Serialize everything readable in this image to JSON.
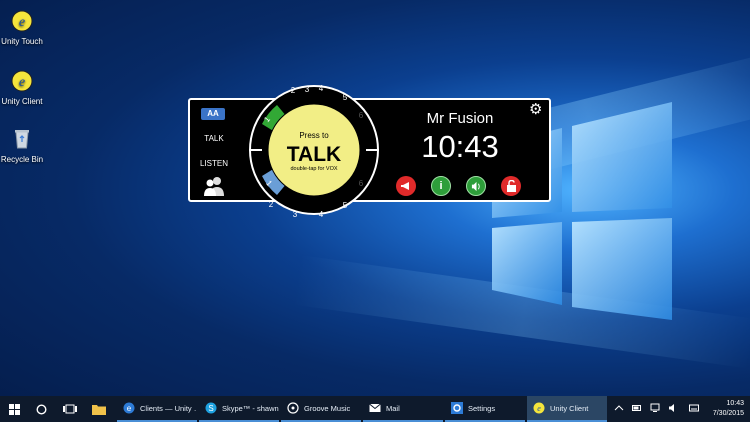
{
  "desktop": {
    "icons": [
      {
        "label": "Unity Touch",
        "icon": "unity-touch-icon"
      },
      {
        "label": "Unity Client",
        "icon": "unity-client-icon"
      },
      {
        "label": "Recycle Bin",
        "icon": "recycle-bin-icon"
      }
    ]
  },
  "widget": {
    "left": {
      "font_size_label": "AA",
      "talk_label": "TALK",
      "listen_label": "LISTEN",
      "users_icon": "users-icon"
    },
    "dial": {
      "press_to": "Press to",
      "talk": "TALK",
      "vox_hint": "double-tap for VOX",
      "top_channels": [
        "1",
        "2",
        "3",
        "4",
        "5",
        "6"
      ],
      "bottom_channels": [
        "1",
        "2",
        "3",
        "4",
        "5",
        "6"
      ]
    },
    "right": {
      "user_name": "Mr Fusion",
      "time": "10:43",
      "actions": [
        {
          "icon": "megaphone-icon",
          "color": "#e02a2a"
        },
        {
          "icon": "info-icon",
          "color": "#2e9e3a"
        },
        {
          "icon": "volume-icon",
          "color": "#2e9e3a"
        },
        {
          "icon": "unlock-icon",
          "color": "#e02a2a"
        }
      ],
      "settings_icon": "gear-icon"
    }
  },
  "taskbar": {
    "items": [
      {
        "label": "Clients — Unity …",
        "icon": "edge-icon"
      },
      {
        "label": "Skype™ - shawn…",
        "icon": "skype-icon"
      },
      {
        "label": "Groove Music",
        "icon": "groove-icon"
      },
      {
        "label": "Mail",
        "icon": "mail-icon"
      },
      {
        "label": "Settings",
        "icon": "settings-icon"
      },
      {
        "label": "Unity Client",
        "icon": "unity-client-icon"
      }
    ],
    "clock_time": "10:43",
    "clock_date": "7/30/2015"
  }
}
